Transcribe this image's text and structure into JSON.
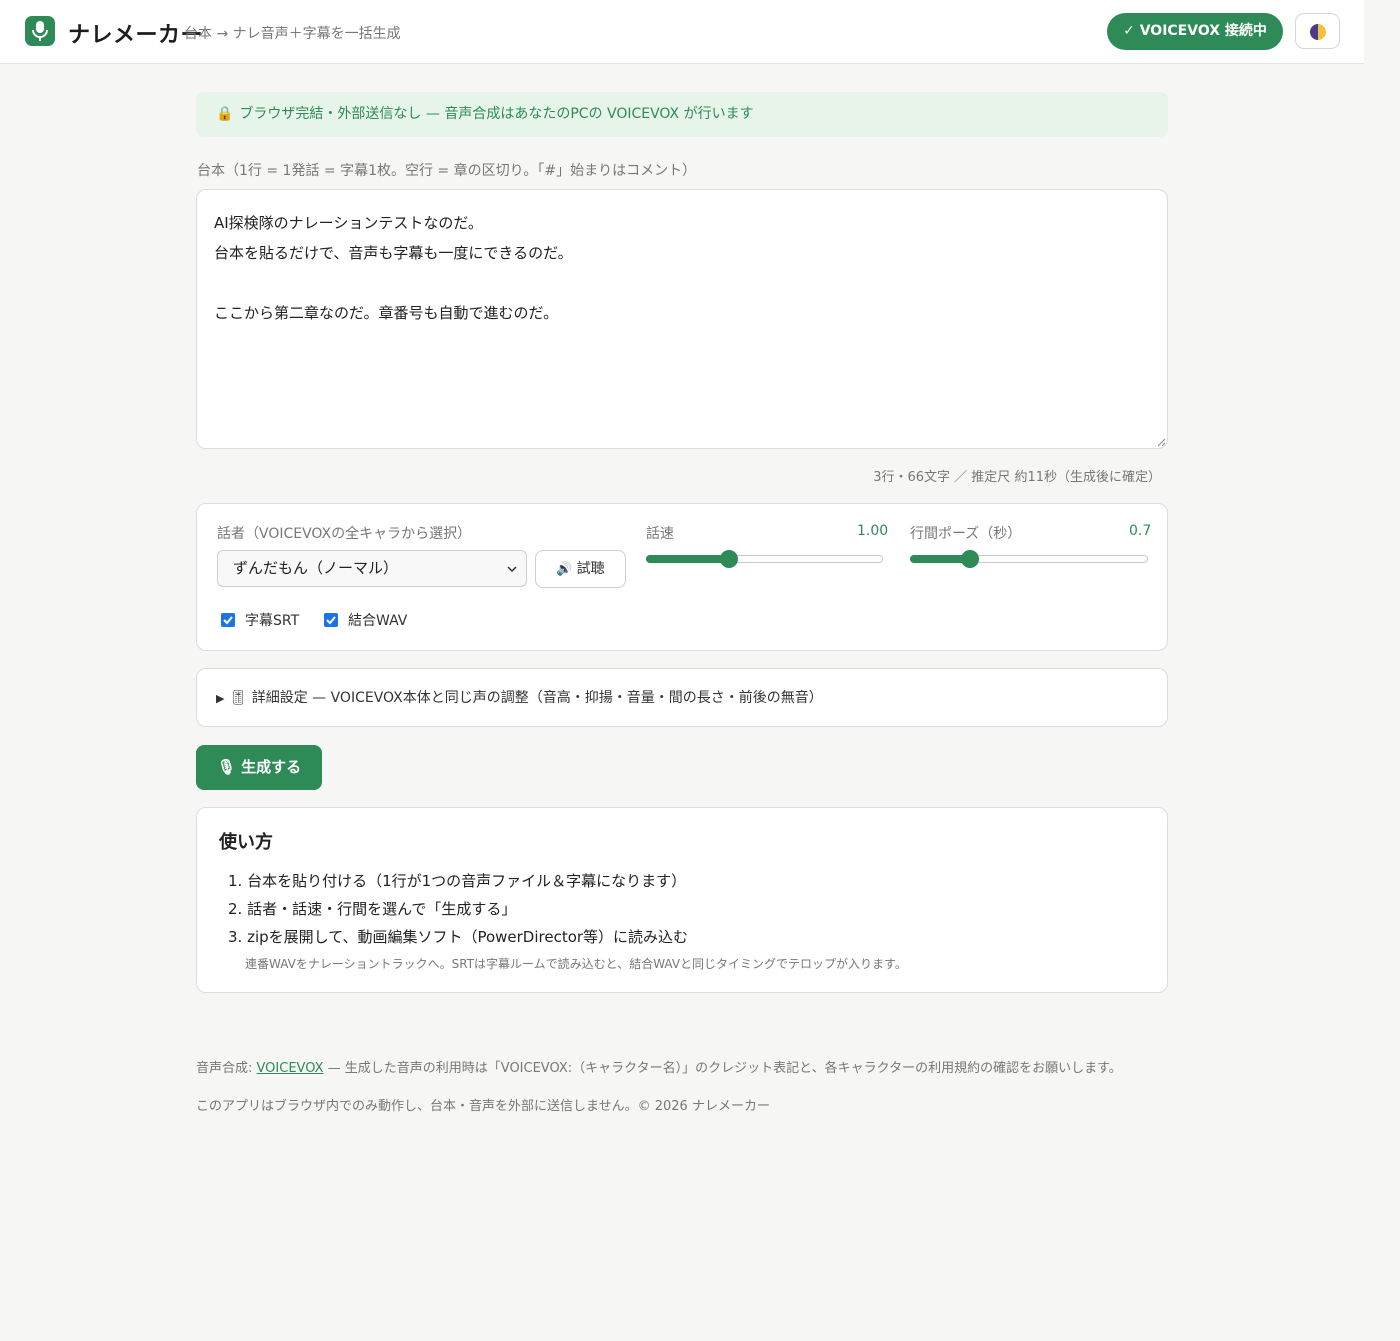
{
  "header": {
    "title": "ナレメーカー",
    "subtitle": "台本 → ナレ音声＋字幕を一括生成",
    "status": "✓ VOICEVOX 接続中",
    "theme_icon": "half-moon-icon"
  },
  "privacy_note": "ブラウザ完結・外部送信なし — 音声合成はあなたのPCの VOICEVOX が行います",
  "script": {
    "label": "台本（1行 = 1発話 = 字幕1枚。空行 = 章の区切り。「#」始まりはコメント）",
    "value": "AI探検隊のナレーションテストなのだ。\n台本を貼るだけで、音声も字幕も一度にできるのだ。\n\nここから第二章なのだ。章番号も自動で進むのだ。",
    "stats": "3行・66文字 ／ 推定尺 約11秒（生成後に確定）"
  },
  "settings": {
    "speaker_label": "話者（VOICEVOXの全キャラから選択）",
    "speaker_value": "ずんだもん（ノーマル）",
    "listen_label": "試聴",
    "speed_label": "話速",
    "speed_value": "1.00",
    "speed_fraction": 0.35,
    "pause_label": "行間ポーズ（秒）",
    "pause_value": "0.7",
    "pause_fraction": 0.25,
    "srt_label": "字幕SRT",
    "wav_label": "結合WAV"
  },
  "advanced": {
    "label": "🎚 詳細設定 — VOICEVOX本体と同じ声の調整（音高・抑揚・音量・間の長さ・前後の無音）"
  },
  "generate_label": "🎙 生成する",
  "howto": {
    "title": "使い方",
    "steps": [
      "1. 台本を貼り付ける（1行が1つの音声ファイル＆字幕になります）",
      "2. 話者・話速・行間を選んで「生成する」",
      "3. zipを展開して、動画編集ソフト（PowerDirector等）に読み込む"
    ],
    "note": "連番WAVをナレーショントラックへ。SRTは字幕ルームで読み込むと、結合WAVと同じタイミングでテロップが入ります。"
  },
  "footer": {
    "credit_prefix": "音声合成: ",
    "credit_link": "VOICEVOX",
    "credit_suffix": " — 生成した音声の利用時は「VOICEVOX:（キャラクター名）」のクレジット表記と、各キャラクターの利用規約の確認をお願いします。",
    "copyright": "このアプリはブラウザ内でのみ動作し、台本・音声を外部に送信しません。© 2026 ナレメーカー"
  },
  "colors": {
    "accent": "#2e8b57",
    "privacy_bg": "#e6f4ea",
    "checkbox": "#1a73e8"
  }
}
